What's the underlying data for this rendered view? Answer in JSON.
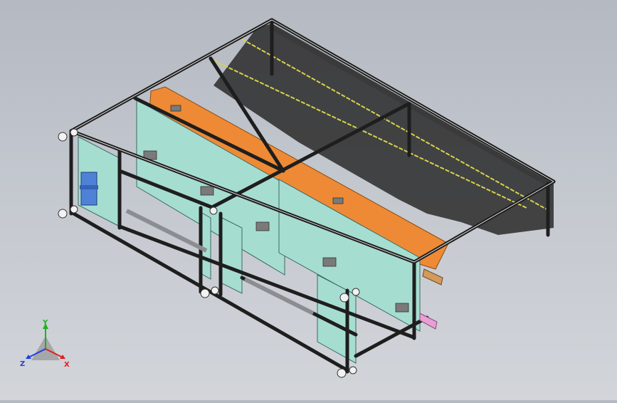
{
  "viewport": {
    "model": "machine-frame-assembly"
  },
  "triad": {
    "x_label": "X",
    "y_label": "Y",
    "z_label": "Z",
    "x_color": "#e02020",
    "y_color": "#20b020",
    "z_color": "#2040e0"
  },
  "colors": {
    "frame": "#1e1e1e",
    "panel": "#a6ddd1",
    "orange_plate": "#ee8a35",
    "yellow_rail": "#d8d34a",
    "motor": "#4f82d6",
    "pink_part": "#e6a0d6",
    "shadow": "#232323"
  }
}
